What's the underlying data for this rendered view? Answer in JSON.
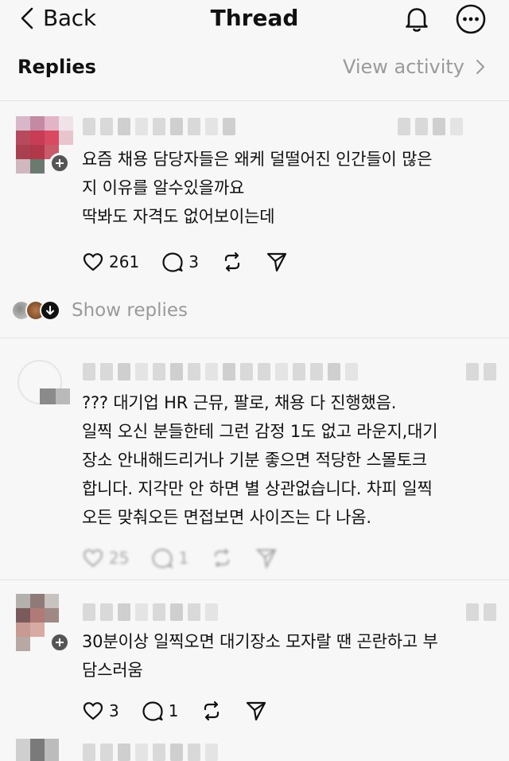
{
  "header": {
    "back_label": "Back",
    "title": "Thread",
    "icons": [
      "chevron-left-icon",
      "bell-icon",
      "more-icon"
    ]
  },
  "subheader": {
    "replies_label": "Replies",
    "view_activity_label": "View activity"
  },
  "comments": [
    {
      "text": "요즘 채용 담당자들은 왜케 덜떨어진 인간들이 많은\n지 이유를 알수있을까요\n딱봐도 자격도 없어보이는데",
      "likes": "261",
      "replies": "3"
    },
    {
      "text": "??? 대기업 HR 근뮤, 팔로, 채용 다 진행했음.\n일찍 오신 분들한테 그런 감정 1도 없고 라운지,대기\n장소 안내해드리거나 기분 좋으면 적당한 스몰토크\n합니다. 지각만 안 하면 별 상관없습니다. 차피 일찍\n오든 맞춰오든 면접보면 사이즈는 다 나옴.",
      "likes": "25",
      "replies": "1"
    },
    {
      "text": "30분이상 일찍오면 대기장소 모자랄 땐 곤란하고 부\n담스러움",
      "likes": "3",
      "replies": "1"
    }
  ],
  "show_replies_label": "Show replies",
  "colors": {
    "background": "#f7f7f7",
    "text": "#111111",
    "muted": "#9a9a9a",
    "divider": "#e2e2e2"
  }
}
